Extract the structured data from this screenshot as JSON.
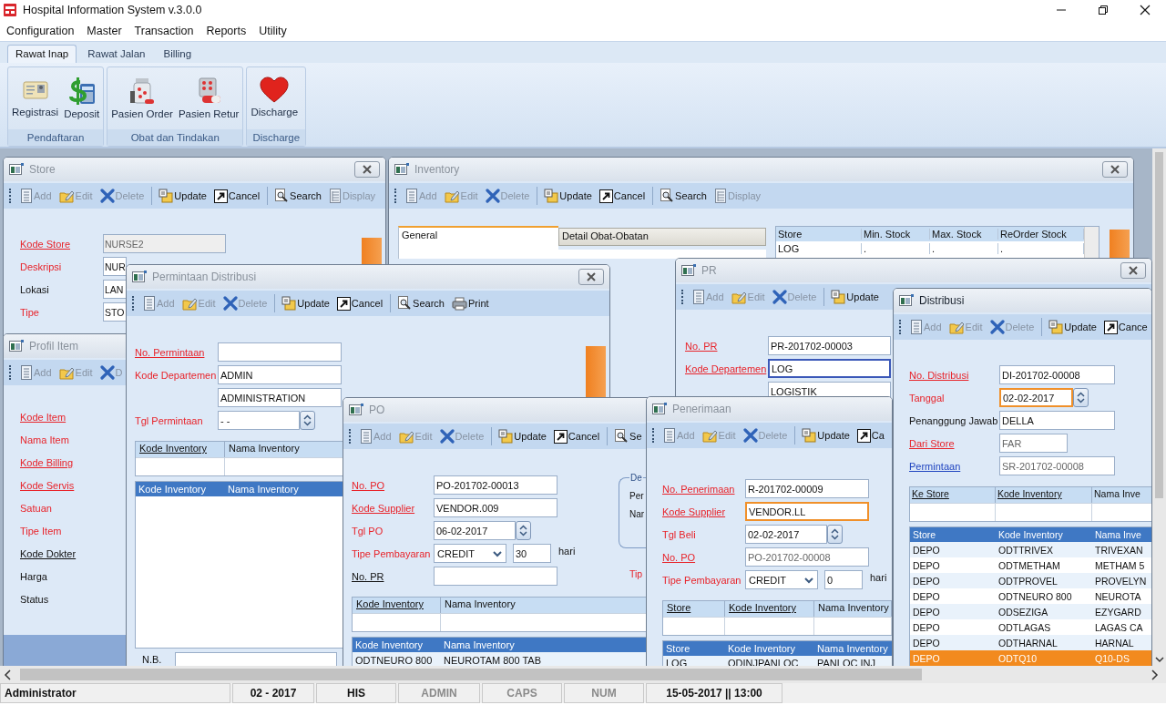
{
  "window": {
    "title": "Hospital Information System v.3.0.0"
  },
  "menu": [
    "Configuration",
    "Master",
    "Transaction",
    "Reports",
    "Utility"
  ],
  "ribbon": {
    "tabs": [
      {
        "label": "Rawat Inap",
        "selected": true
      },
      {
        "label": "Rawat Jalan",
        "selected": false
      },
      {
        "label": "Billing",
        "selected": false
      }
    ],
    "groups": [
      {
        "label": "Pendaftaran",
        "buttons": [
          "Registrasi",
          "Deposit"
        ]
      },
      {
        "label": "Obat dan Tindakan",
        "buttons": [
          "Pasien Order",
          "Pasien Retur"
        ]
      },
      {
        "label": "Discharge",
        "buttons": [
          "Discharge"
        ]
      }
    ]
  },
  "mdi_windows": [
    {
      "title": "Store",
      "active": false,
      "close": true,
      "side_panel": true,
      "toolbar": [
        {
          "label": "Add",
          "kind": "add",
          "disabled": true,
          "separator_before": false
        },
        {
          "label": "Edit",
          "kind": "edit",
          "disabled": true,
          "separator_before": false
        },
        {
          "label": "Delete",
          "kind": "delete",
          "disabled": true,
          "separator_before": false
        },
        {
          "label": "Update",
          "kind": "update",
          "disabled": false,
          "separator_before": true
        },
        {
          "label": "Cancel",
          "kind": "cancel",
          "disabled": false,
          "separator_before": false
        },
        {
          "label": "Search",
          "kind": "search",
          "disabled": false,
          "separator_before": true
        },
        {
          "label": "Display",
          "kind": "display",
          "disabled": true,
          "separator_before": false
        }
      ],
      "form": [
        {
          "label": "Kode Store",
          "kind": "required",
          "underlined": true,
          "fields": [
            {
              "kind": "disabled",
              "value": "NURSE2"
            }
          ]
        },
        {
          "label": "Deskripsi",
          "kind": "required",
          "underlined": false,
          "fields": [
            {
              "kind": "text",
              "value": "NUR"
            }
          ]
        },
        {
          "label": "Lokasi",
          "kind": "plain",
          "underlined": false,
          "fields": [
            {
              "kind": "text",
              "value": "LAN"
            }
          ]
        },
        {
          "label": "Tipe",
          "kind": "required",
          "underlined": false,
          "fields": [
            {
              "kind": "text",
              "value": "STO"
            }
          ]
        }
      ]
    },
    {
      "title": "Inventory",
      "active": false,
      "close": true,
      "side_panel": true,
      "toolbar": [
        {
          "label": "Add",
          "kind": "add",
          "disabled": true,
          "separator_before": false
        },
        {
          "label": "Edit",
          "kind": "edit",
          "disabled": true,
          "separator_before": false
        },
        {
          "label": "Delete",
          "kind": "delete",
          "disabled": true,
          "separator_before": false
        },
        {
          "label": "Update",
          "kind": "update",
          "disabled": false,
          "separator_before": true
        },
        {
          "label": "Cancel",
          "kind": "cancel",
          "disabled": false,
          "separator_before": false
        },
        {
          "label": "Search",
          "kind": "search",
          "disabled": false,
          "separator_before": true
        },
        {
          "label": "Display",
          "kind": "display",
          "disabled": true,
          "separator_before": false
        }
      ],
      "tabs": [
        {
          "label": "General",
          "selected": true
        },
        {
          "label": "Detail Obat-Obatan",
          "selected": false
        }
      ],
      "stock_table": {
        "columns": [
          "Store",
          "Min. Stock",
          "Max. Stock",
          "ReOrder Stock"
        ],
        "rows": [
          [
            "LOG",
            ".",
            ".",
            "."
          ]
        ]
      }
    },
    {
      "title": "Profil Item",
      "active": false,
      "close": false,
      "footer_panel": true,
      "toolbar": [
        {
          "label": "Add",
          "kind": "add",
          "disabled": true,
          "separator_before": false
        },
        {
          "label": "Edit",
          "kind": "edit",
          "disabled": true,
          "separator_before": false
        },
        {
          "label": "D",
          "kind": "delete",
          "disabled": true,
          "separator_before": false
        }
      ],
      "form": [
        {
          "label": "Kode Item",
          "kind": "required",
          "underlined": true
        },
        {
          "label": "Nama Item",
          "kind": "required",
          "underlined": false
        },
        {
          "label": "Kode Billing",
          "kind": "required",
          "underlined": true
        },
        {
          "label": "Kode Servis",
          "kind": "required",
          "underlined": true
        },
        {
          "label": "Satuan",
          "kind": "required",
          "underlined": false
        },
        {
          "label": "Tipe Item",
          "kind": "required",
          "underlined": false
        },
        {
          "label": "Kode Dokter",
          "kind": "plain",
          "underlined": true
        },
        {
          "label": "Harga",
          "kind": "plain",
          "underlined": false
        },
        {
          "label": "Status",
          "kind": "plain",
          "underlined": false
        }
      ]
    },
    {
      "title": "Permintaan Distribusi",
      "active": false,
      "close": true,
      "side_panel": true,
      "toolbar": [
        {
          "label": "Add",
          "kind": "add",
          "disabled": true,
          "separator_before": false
        },
        {
          "label": "Edit",
          "kind": "edit",
          "disabled": true,
          "separator_before": false
        },
        {
          "label": "Delete",
          "kind": "delete",
          "disabled": true,
          "separator_before": false
        },
        {
          "label": "Update",
          "kind": "update",
          "disabled": false,
          "separator_before": true
        },
        {
          "label": "Cancel",
          "kind": "cancel",
          "disabled": false,
          "separator_before": false
        },
        {
          "label": "Search",
          "kind": "search",
          "disabled": false,
          "separator_before": true
        },
        {
          "label": "Print",
          "kind": "print",
          "disabled": false,
          "separator_before": false
        }
      ],
      "form": [
        {
          "label": "No. Permintaan",
          "kind": "required",
          "underlined": true,
          "fields": [
            {
              "kind": "text"
            }
          ]
        },
        {
          "label": "Kode Departemen",
          "kind": "required",
          "underlined": false,
          "fields": [
            {
              "kind": "text",
              "value": "ADMIN"
            }
          ]
        },
        {
          "fields": [
            {
              "kind": "text",
              "value": "ADMINISTRATION"
            }
          ]
        },
        {
          "label": "Tgl Permintaan",
          "kind": "required",
          "underlined": false,
          "fields": [
            {
              "kind": "date",
              "value": "- -"
            }
          ]
        }
      ],
      "table": {
        "columns": [
          {
            "label": "Kode Inventory",
            "underlined": true
          },
          {
            "label": "Nama Inventory",
            "underlined": false
          }
        ]
      },
      "list": {
        "columns": [
          "Kode Inventory",
          "Nama Inventory"
        ]
      },
      "note": {
        "label": "N.B."
      }
    },
    {
      "title": "PR",
      "active": false,
      "close": true,
      "toolbar": [
        {
          "label": "Add",
          "kind": "add",
          "disabled": true,
          "separator_before": false
        },
        {
          "label": "Edit",
          "kind": "edit",
          "disabled": true,
          "separator_before": false
        },
        {
          "label": "Delete",
          "kind": "delete",
          "disabled": true,
          "separator_before": false
        },
        {
          "label": "Update",
          "kind": "update",
          "disabled": false,
          "separator_before": true
        }
      ],
      "form": [
        {
          "label": "No. PR",
          "kind": "required",
          "underlined": true,
          "fields": [
            {
              "kind": "text",
              "value": "PR-201702-00003"
            }
          ]
        },
        {
          "label": "Kode Departemen",
          "kind": "required",
          "underlined": true,
          "fields": [
            {
              "kind": "text",
              "value": "LOG",
              "hovered": true
            }
          ]
        },
        {
          "fields": [
            {
              "kind": "text",
              "value": "LOGISTIK"
            }
          ]
        }
      ]
    },
    {
      "title": "PO",
      "active": false,
      "close": false,
      "toolbar": [
        {
          "label": "Add",
          "kind": "add",
          "disabled": true,
          "separator_before": false
        },
        {
          "label": "Edit",
          "kind": "edit",
          "disabled": true,
          "separator_before": false
        },
        {
          "label": "Delete",
          "kind": "delete",
          "disabled": true,
          "separator_before": false
        },
        {
          "label": "Update",
          "kind": "update",
          "disabled": false,
          "separator_before": true
        },
        {
          "label": "Cancel",
          "kind": "cancel",
          "disabled": false,
          "separator_before": false
        },
        {
          "label": "Se",
          "kind": "search",
          "disabled": false,
          "separator_before": true
        }
      ],
      "form": [
        {
          "label": "No. PO",
          "kind": "required",
          "underlined": true,
          "fields": [
            {
              "kind": "text",
              "value": "PO-201702-00013"
            }
          ]
        },
        {
          "label": "Kode Supplier",
          "kind": "required",
          "underlined": true,
          "fields": [
            {
              "kind": "text",
              "value": "VENDOR.009"
            }
          ]
        },
        {
          "label": "Tgl PO",
          "kind": "required",
          "underlined": false,
          "fields": [
            {
              "kind": "date",
              "value": "06-02-2017"
            }
          ]
        },
        {
          "label": "Tipe Pembayaran",
          "kind": "required",
          "underlined": false,
          "fields": [
            {
              "kind": "combo",
              "value": "CREDIT"
            },
            {
              "kind": "small",
              "value": "30"
            }
          ],
          "suffix": "hari"
        },
        {
          "label": "No. PR",
          "kind": "plain",
          "underlined": true,
          "fields": [
            {
              "kind": "text"
            }
          ]
        }
      ],
      "group_box": {
        "title": "De",
        "labels": [
          "Per",
          "Nar"
        ]
      },
      "aside_label": {
        "text": "Tip",
        "kind": "required"
      },
      "table": {
        "columns": [
          {
            "label": "Kode Inventory",
            "underlined": true
          },
          {
            "label": "Nama Inventory",
            "underlined": false
          }
        ]
      },
      "list": {
        "columns": [
          "Kode Inventory",
          "Nama Inventory"
        ],
        "rows": [
          {
            "cells": [
              "ODTNEURO 800",
              "NEUROTAM 800 TAB"
            ],
            "selected": false
          }
        ]
      }
    },
    {
      "title": "Penerimaan",
      "active": false,
      "close": false,
      "toolbar": [
        {
          "label": "Add",
          "kind": "add",
          "disabled": true,
          "separator_before": false
        },
        {
          "label": "Edit",
          "kind": "edit",
          "disabled": true,
          "separator_before": false
        },
        {
          "label": "Delete",
          "kind": "delete",
          "disabled": true,
          "separator_before": false
        },
        {
          "label": "Update",
          "kind": "update",
          "disabled": false,
          "separator_before": true
        },
        {
          "label": "Ca",
          "kind": "cancel",
          "disabled": false,
          "separator_before": false
        }
      ],
      "form": [
        {
          "label": "No. Penerimaan",
          "kind": "required",
          "underlined": true,
          "fields": [
            {
              "kind": "text",
              "value": "R-201702-00009"
            }
          ]
        },
        {
          "label": "Kode Supplier",
          "kind": "required",
          "underlined": true,
          "fields": [
            {
              "kind": "text",
              "value": "VENDOR.LL",
              "focused": true
            }
          ]
        },
        {
          "label": "Tgl Beli",
          "kind": "required",
          "underlined": false,
          "fields": [
            {
              "kind": "date",
              "value": "02-02-2017"
            }
          ]
        },
        {
          "label": "No. PO",
          "kind": "required",
          "underlined": true,
          "fields": [
            {
              "kind": "readonly",
              "value": "PO-201702-00008"
            }
          ]
        },
        {
          "label": "Tipe Pembayaran",
          "kind": "required",
          "underlined": false,
          "fields": [
            {
              "kind": "combo",
              "value": "CREDIT"
            },
            {
              "kind": "small",
              "value": "0"
            }
          ],
          "suffix": "hari"
        }
      ],
      "table": {
        "columns": [
          {
            "label": "Store",
            "underlined": true
          },
          {
            "label": "Kode Inventory",
            "underlined": true
          },
          {
            "label": "Nama Inventory",
            "underlined": false
          }
        ]
      },
      "list": {
        "columns": [
          "Store",
          "Kode Inventory",
          "Nama Inventory"
        ],
        "rows": [
          {
            "cells": [
              "LOG",
              "ODINJPANLOC",
              "PANLOC INJ"
            ],
            "selected": false
          }
        ]
      }
    },
    {
      "title": "Distribusi",
      "active": true,
      "close": false,
      "toolbar": [
        {
          "label": "Add",
          "kind": "add",
          "disabled": true,
          "separator_before": false
        },
        {
          "label": "Edit",
          "kind": "edit",
          "disabled": true,
          "separator_before": false
        },
        {
          "label": "Delete",
          "kind": "delete",
          "disabled": true,
          "separator_before": false
        },
        {
          "label": "Update",
          "kind": "update",
          "disabled": false,
          "separator_before": true
        },
        {
          "label": "Cance",
          "kind": "cancel",
          "disabled": false,
          "separator_before": false
        }
      ],
      "form": [
        {
          "label": "No. Distribusi",
          "kind": "required",
          "underlined": true,
          "fields": [
            {
              "kind": "text",
              "value": "DI-201702-00008"
            }
          ]
        },
        {
          "label": "Tanggal",
          "kind": "required",
          "underlined": false,
          "fields": [
            {
              "kind": "date",
              "value": "02-02-2017",
              "focused": true
            }
          ]
        },
        {
          "label": "Penanggung Jawab",
          "kind": "plain",
          "underlined": false,
          "fields": [
            {
              "kind": "text",
              "value": "DELLA"
            }
          ]
        },
        {
          "label": "Dari Store",
          "kind": "required",
          "underlined": true,
          "fields": [
            {
              "kind": "readonly",
              "value": "FAR"
            }
          ]
        },
        {
          "label": "Permintaan",
          "kind": "link",
          "underlined": true,
          "fields": [
            {
              "kind": "readonly",
              "value": "SR-201702-00008"
            }
          ]
        }
      ],
      "table": {
        "columns": [
          {
            "label": "Ke Store",
            "underlined": true
          },
          {
            "label": "Kode Inventory",
            "underlined": true
          },
          {
            "label": "Nama Inve",
            "underlined": false
          }
        ]
      },
      "list": {
        "columns": [
          "Store",
          "Kode Inventory",
          "Nama Inve"
        ],
        "rows": [
          {
            "cells": [
              "DEPO",
              "ODTTRIVEX",
              "TRIVEXAN"
            ],
            "selected": false
          },
          {
            "cells": [
              "DEPO",
              "ODTMETHAM",
              "METHAM 5"
            ],
            "selected": false
          },
          {
            "cells": [
              "DEPO",
              "ODTPROVEL",
              "PROVELYN"
            ],
            "selected": false
          },
          {
            "cells": [
              "DEPO",
              "ODTNEURO 800",
              "NEUROTA"
            ],
            "selected": false
          },
          {
            "cells": [
              "DEPO",
              "ODSEZIGA",
              "EZYGARD"
            ],
            "selected": false
          },
          {
            "cells": [
              "DEPO",
              "ODTLAGAS",
              "LAGAS CA"
            ],
            "selected": false
          },
          {
            "cells": [
              "DEPO",
              "ODTHARNAL",
              "HARNAL"
            ],
            "selected": false
          },
          {
            "cells": [
              "DEPO",
              "ODTQ10",
              "Q10-DS"
            ],
            "selected": true
          }
        ]
      }
    }
  ],
  "status_bar": [
    {
      "text": "Administrator",
      "dimmed": false
    },
    {
      "text": "02 - 2017",
      "dimmed": false
    },
    {
      "text": "HIS",
      "dimmed": false
    },
    {
      "text": "ADMIN",
      "dimmed": true
    },
    {
      "text": "CAPS",
      "dimmed": true
    },
    {
      "text": "NUM",
      "dimmed": true
    },
    {
      "text": "15-05-2017 || 13:00",
      "dimmed": false
    }
  ]
}
